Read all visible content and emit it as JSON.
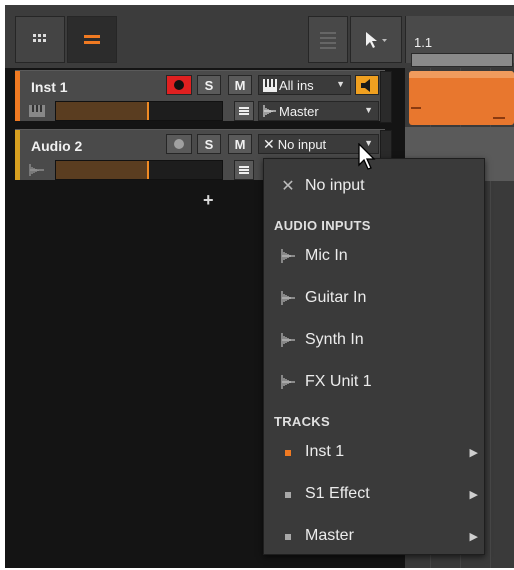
{
  "toolbar": {
    "grid_icon": "grid-icon",
    "list_icon": "list-icon",
    "pointer_icon": "pointer-tool-icon",
    "timeline_position": "1.1"
  },
  "tracks": [
    {
      "name": "Inst 1",
      "color": "#f07a22",
      "solo_label": "S",
      "mute_label": "M",
      "input_label": "All ins",
      "output_label": "Master",
      "meter_fraction": 0.55
    },
    {
      "name": "Audio 2",
      "color": "#d8a020",
      "solo_label": "S",
      "mute_label": "M",
      "input_label": "No input",
      "meter_fraction": 0.55
    }
  ],
  "add_track_label": "+",
  "dropdown": {
    "no_input_label": "No input",
    "audio_inputs_header": "AUDIO INPUTS",
    "audio_inputs": [
      {
        "label": "Mic In"
      },
      {
        "label": "Guitar In"
      },
      {
        "label": "Synth In"
      },
      {
        "label": "FX Unit 1"
      }
    ],
    "tracks_header": "TRACKS",
    "tracks": [
      {
        "label": "Inst 1",
        "color": "#f07a22"
      },
      {
        "label": "S1 Effect",
        "color": "#a8a8a8"
      },
      {
        "label": "Master",
        "color": "#a8a8a8"
      }
    ]
  },
  "colors": {
    "accent": "#f07a22",
    "record": "#e02020",
    "audio": "#d8a020"
  }
}
